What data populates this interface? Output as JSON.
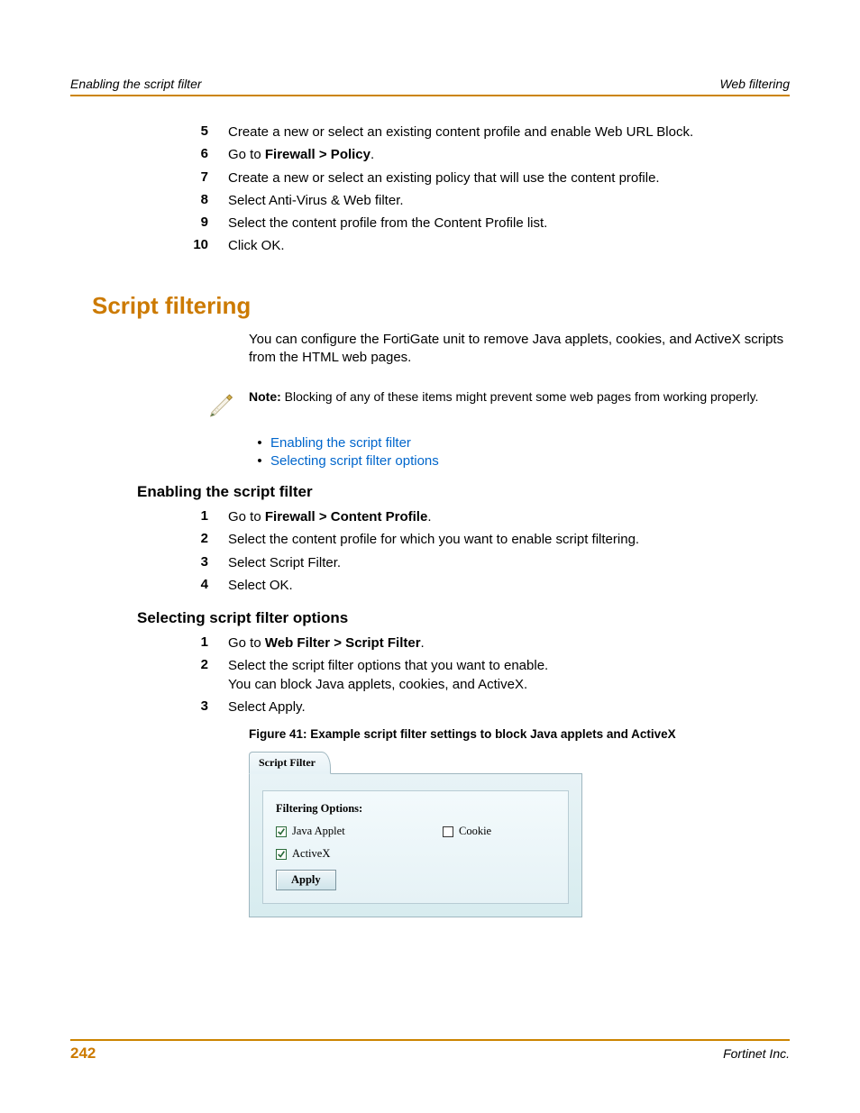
{
  "header": {
    "left": "Enabling the script filter",
    "right": "Web filtering"
  },
  "topSteps": [
    {
      "num": "5",
      "html": "Create a new or select an existing content profile and enable Web URL Block."
    },
    {
      "num": "6",
      "html": "Go to <b>Firewall > Policy</b>."
    },
    {
      "num": "7",
      "html": "Create a new or select an existing policy that will use the content profile."
    },
    {
      "num": "8",
      "html": "Select Anti-Virus & Web filter."
    },
    {
      "num": "9",
      "html": "Select the content profile from the Content Profile list."
    },
    {
      "num": "10",
      "html": "Click OK."
    }
  ],
  "mainHeading": "Script filtering",
  "intro": "You can configure the FortiGate unit to remove Java applets, cookies, and ActiveX scripts from the HTML web pages.",
  "note": {
    "label": "Note:",
    "text": " Blocking of any of these items might prevent some web pages from working properly."
  },
  "links": [
    {
      "text": "Enabling the script filter"
    },
    {
      "text": "Selecting script filter options"
    }
  ],
  "sec1": {
    "title": "Enabling the script filter",
    "steps": [
      {
        "num": "1",
        "html": "Go to <b>Firewall > Content Profile</b>."
      },
      {
        "num": "2",
        "html": "Select the content profile for which you want to enable script filtering."
      },
      {
        "num": "3",
        "html": "Select Script Filter."
      },
      {
        "num": "4",
        "html": "Select OK."
      }
    ]
  },
  "sec2": {
    "title": "Selecting script filter options",
    "steps": [
      {
        "num": "1",
        "html": "Go to <b>Web Filter > Script Filter</b>."
      },
      {
        "num": "2",
        "html": "Select the script filter options that you want to enable.<br>You can block Java applets, cookies, and ActiveX."
      },
      {
        "num": "3",
        "html": "Select Apply."
      }
    ]
  },
  "figCaption": "Figure 41: Example script filter settings to block Java applets and ActiveX",
  "ui": {
    "tab": "Script Filter",
    "boxTitle": "Filtering Options:",
    "opts": {
      "java": {
        "label": "Java Applet",
        "checked": true
      },
      "cookie": {
        "label": "Cookie",
        "checked": false
      },
      "activex": {
        "label": "ActiveX",
        "checked": true
      }
    },
    "apply": "Apply"
  },
  "footer": {
    "page": "242",
    "company": "Fortinet Inc."
  }
}
